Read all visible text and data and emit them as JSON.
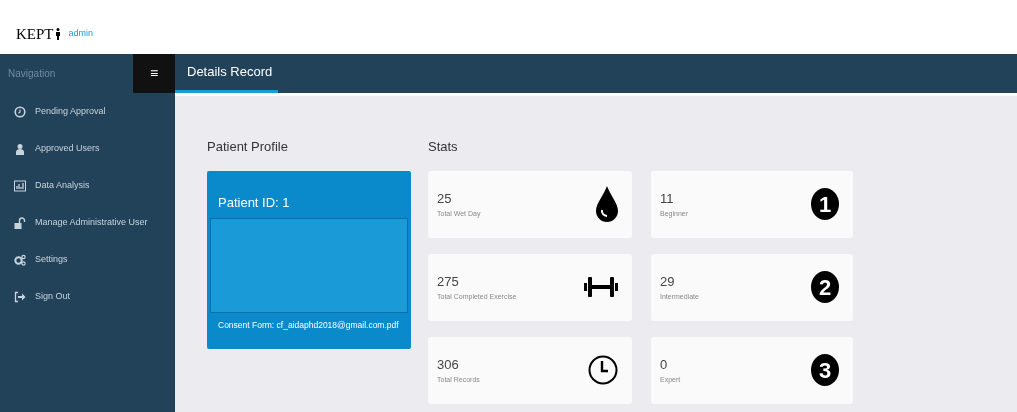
{
  "header": {
    "logo": "KEPT",
    "user": "admin"
  },
  "sidebar": {
    "title": "Navigation",
    "toggle": "≡",
    "items": [
      {
        "label": "Pending Approval",
        "kind": "clock"
      },
      {
        "label": "Approved Users",
        "kind": "user"
      },
      {
        "label": "Data Analysis",
        "kind": "chart"
      },
      {
        "label": "Manage Administrative User",
        "kind": "lock"
      },
      {
        "label": "Settings",
        "kind": "gears"
      },
      {
        "label": "Sign Out",
        "kind": "signout"
      }
    ]
  },
  "page_title": "Details Record",
  "profile": {
    "heading": "Patient Profile",
    "patient_id": "Patient ID: 1",
    "consent_form": "Consent Form: cf_aidaphd2018@gmail.com.pdf"
  },
  "stats": {
    "heading": "Stats",
    "cards": [
      {
        "value": "25",
        "label": "Total Wet Day",
        "kind": "drop"
      },
      {
        "value": "11",
        "label": "Beginner",
        "kind": "number",
        "number": "1"
      },
      {
        "value": "275",
        "label": "Total Completed Exercise",
        "kind": "dumbbell"
      },
      {
        "value": "29",
        "label": "Intermediate",
        "kind": "number",
        "number": "2"
      },
      {
        "value": "306",
        "label": "Total Records",
        "kind": "clock"
      },
      {
        "value": "0",
        "label": "Expert",
        "kind": "number",
        "number": "3"
      }
    ]
  }
}
